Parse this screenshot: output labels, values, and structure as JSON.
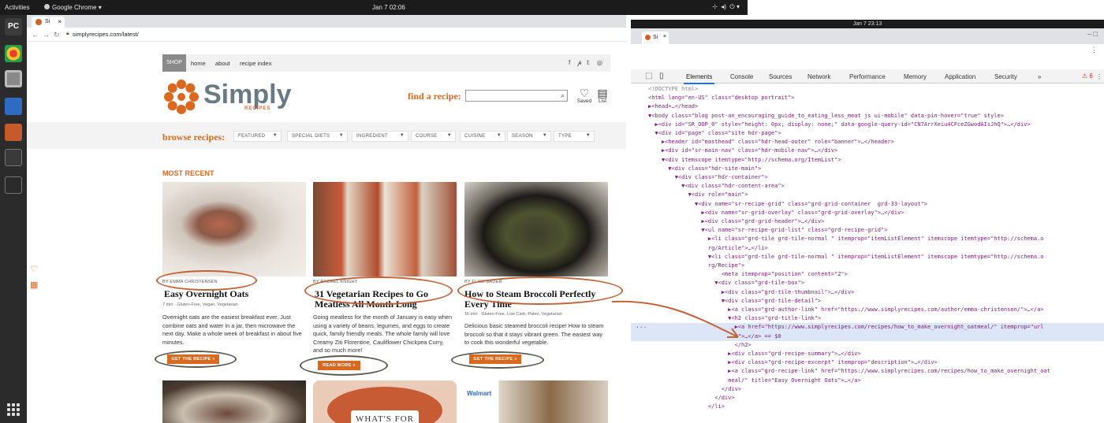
{
  "topbar": {
    "activities": "Activities",
    "app": "Google Chrome ▾",
    "clock": "Jan 7  02:06"
  },
  "browser_left": {
    "tab_title": "Si",
    "url": "simplyrecipes.com/latest/"
  },
  "site": {
    "nav": {
      "shop": "SHOP",
      "home": "home",
      "about": "about",
      "recipe_index": "recipe index"
    },
    "social": [
      "f",
      "𝓅",
      "𝕥",
      "◎"
    ],
    "logo": {
      "word": "Simply",
      "sub": "RECIPES"
    },
    "find_label": "find a recipe:",
    "saved_label": "Saved",
    "list_label": "List",
    "browse_label": "browse recipes:",
    "filters": [
      "FEATURED",
      "SPECIAL DIETS",
      "INGREDIENT",
      "COURSE",
      "CUISINE",
      "SEASON",
      "TYPE"
    ],
    "section_title": "MOST RECENT",
    "cards": [
      {
        "byline": "BY EMMA CHRISTENSEN",
        "title": "Easy Overnight Oats",
        "meta": "7 min  ·  Gluten-Free, Vegan, Vegetarian",
        "excerpt": "Overnight oats are the easiest breakfast ever. Just combine oats and water in a jar, then microwave the next day. Make a whole week of breakfast in about five minutes.",
        "cta": "GET THE RECIPE »"
      },
      {
        "byline": "BY RACHEL KNIGHT",
        "title": "31 Vegetarian Recipes to Go Meatless All Month Long",
        "meta": "",
        "excerpt": "Going meatless for the month of January is easy when using a variety of beans, legumes, and eggs to create quick, family friendly meals. The whole family will love Creamy Ziti Florentine, Cauliflower Chickpea Curry, and so much more!",
        "cta": "READ MORE »"
      },
      {
        "byline": "BY ELISE BAUER",
        "title": "How to Steam Broccoli Perfectly Every Time",
        "meta": "15 min  ·  Gluten-Free, Low Carb, Paleo, Vegetarian",
        "excerpt": "Delicious basic steamed broccoli recipe! How to steam broccoli so that it stays vibrant green. The easiest way to cook this wonderful vegetable.",
        "cta": "GET THE RECIPE »"
      }
    ],
    "promo_text": "WHAT'S FOR",
    "walmart": "Walmart"
  },
  "devtools": {
    "clock": "Jan 7  23:13",
    "tab_title": "Si",
    "tabs": [
      "Elements",
      "Console",
      "Sources",
      "Network",
      "Performance",
      "Memory",
      "Application",
      "Security",
      "»"
    ],
    "error_count": "6",
    "lines": [
      "<!DOCTYPE html>",
      "<html lang=\"en-US\" class=\"desktop portrait\">",
      "▶<head>…</head>",
      "▼<body class=\"blog post-an_encouraging_guide_to_eating_less_meat js ui-mobile\" data-pin-hover=\"true\" style>",
      "  ▶<div id=\"SR_OOP_0\" style=\"height: 0px; display: none;\" data-google-query-id=\"CN7ArrXeiu4CFceZGwodAIsJhQ\">…</div>",
      "  ▼<div id=\"page\" class=\"site hdr-page\">",
      "    ▶<header id=\"masthead\" class=\"hdr-head-outer\" role=\"banner\">…</header>",
      "    ▶<div id=\"sr-main-nav\" class=\"hdr-mobile-nav\">…</div>",
      "    ▼<div itemscope itemtype=\"http://schema.org/ItemList\">",
      "      ▼<div class=\"hdr-site-main\">",
      "        ▼<div class=\"hdr-container\">",
      "          ▼<div class=\"hdr-content-area\">",
      "            ▼<div role=\"main\">",
      "              ▼<div name=\"sr-recipe-grid\" class=\"grd-grid-container  grd-33-layout\">",
      "                ▶<div name=\"sr-grid-overlay\" class=\"grd-grid-overlay\">…</div>",
      "                ▶<div class=\"grd-grid-header\">…</div>",
      "                ▼<ul name=\"sr-recipe-grid-list\" class=\"grd-recipe-grid\">",
      "                  ▶<li class=\"grd-tile grd-tile-normal \" itemprop=\"itemListElement\" itemscope itemtype=\"http://schema.o",
      "                  rg/Article\">…</li>",
      "                  ▼<li class=\"grd-tile grd-tile-normal \" itemprop=\"itemListElement\" itemscope itemtype=\"http://schema.o",
      "                  rg/Recipe\">",
      "                      <meta itemprop=\"position\" content=\"2\">",
      "                    ▼<div class=\"grd-tile-box\">",
      "                      ▶<div class=\"grd-tile-thumbnail\">…</div>",
      "                      ▼<div class=\"grd-tile-detail\">",
      "                        ▶<a class=\"grd-author-link\" href=\"https://www.simplyrecipes.com/author/emma-christensen/\">…</a>",
      "                        ▼<h2 class=\"grd-title-link\">",
      "                          ▶<a href=\"https://www.simplyrecipes.com/recipes/how_to_make_overnight_oatmeal/\" itemprop=\"url",
      "                          l\">…</a> == $0",
      "                          </h2>",
      "                        ▶<div class=\"grd-recipe-summary\">…</div>",
      "                        ▶<div class=\"grd-recipe-excerpt\" itemprop=\"description\">…</div>",
      "                        ▶<a class=\"grd-recipe-link\" href=\"https://www.simplyrecipes.com/recipes/how_to_make_overnight_oat",
      "                        meal/\" title=\"Easy Overnight Oats\">…</a>",
      "                      </div>",
      "                    </div>",
      "                  </li>"
    ]
  },
  "colors": {
    "accent": "#d8691f",
    "annotation": "#c0623a",
    "selection": "#dce6f6"
  }
}
